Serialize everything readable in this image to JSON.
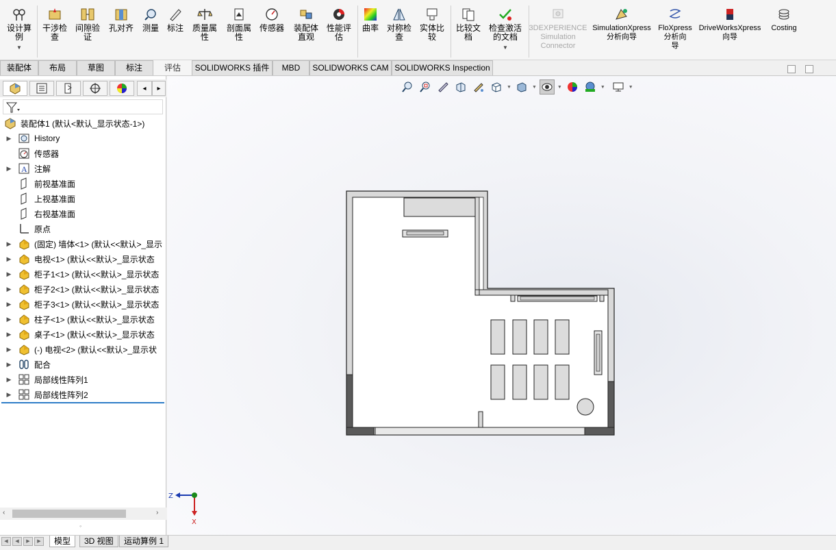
{
  "ribbon": {
    "buttons": [
      {
        "label": "设计算\n例",
        "icon": "design-study-icon"
      },
      {
        "label": "干涉检\n查",
        "icon": "interference-icon"
      },
      {
        "label": "间隙验\n证",
        "icon": "clearance-icon"
      },
      {
        "label": "孔对齐",
        "icon": "hole-align-icon"
      },
      {
        "label": "测量",
        "icon": "measure-icon"
      },
      {
        "label": "标注",
        "icon": "markup-icon"
      },
      {
        "label": "质量属\n性",
        "icon": "mass-props-icon"
      },
      {
        "label": "剖面属\n性",
        "icon": "section-props-icon"
      },
      {
        "label": "传感器",
        "icon": "sensor-icon"
      },
      {
        "label": "装配体\n直观",
        "icon": "assembly-visual-icon"
      },
      {
        "label": "性能评\n估",
        "icon": "performance-icon"
      },
      {
        "label": "曲率",
        "icon": "curvature-icon"
      },
      {
        "label": "对称检\n查",
        "icon": "symmetry-icon"
      },
      {
        "label": "实体比\n较",
        "icon": "body-compare-icon"
      },
      {
        "label": "比较文\n档",
        "icon": "compare-docs-icon"
      },
      {
        "label": "检查激活\n的文档",
        "icon": "check-doc-icon"
      },
      {
        "label": "3DEXPERIENCE\nSimulation\nConnector",
        "icon": "3dx-icon"
      },
      {
        "label": "SimulationXpress\n分析向导",
        "icon": "simxpress-icon"
      },
      {
        "label": "FloXpress\n分析向\n导",
        "icon": "floxpress-icon"
      },
      {
        "label": "DriveWorksXpress\n向导",
        "icon": "driveworks-icon"
      },
      {
        "label": "Costing",
        "icon": "costing-icon"
      }
    ]
  },
  "tabs": [
    {
      "label": "装配体"
    },
    {
      "label": "布局"
    },
    {
      "label": "草图"
    },
    {
      "label": "标注"
    },
    {
      "label": "评估"
    },
    {
      "label": "SOLIDWORKS 插件"
    },
    {
      "label": "MBD"
    },
    {
      "label": "SOLIDWORKS CAM"
    },
    {
      "label": "SOLIDWORKS Inspection"
    }
  ],
  "tree": {
    "root": "装配体1  (默认<默认_显示状态-1>)",
    "items": [
      {
        "label": "History",
        "icon": "history-icon"
      },
      {
        "label": "传感器",
        "icon": "sensor-icon"
      },
      {
        "label": "注解",
        "icon": "annotation-icon"
      },
      {
        "label": "前视基准面",
        "icon": "plane-icon"
      },
      {
        "label": "上视基准面",
        "icon": "plane-icon"
      },
      {
        "label": "右视基准面",
        "icon": "plane-icon"
      },
      {
        "label": "原点",
        "icon": "origin-icon"
      },
      {
        "label": "(固定) 墙体<1> (默认<<默认>_显示",
        "icon": "part-icon"
      },
      {
        "label": "电视<1> (默认<<默认>_显示状态",
        "icon": "part-icon"
      },
      {
        "label": "柜子1<1> (默认<<默认>_显示状态",
        "icon": "part-icon"
      },
      {
        "label": "柜子2<1> (默认<<默认>_显示状态",
        "icon": "part-icon"
      },
      {
        "label": "柜子3<1> (默认<<默认>_显示状态",
        "icon": "part-icon"
      },
      {
        "label": "柱子<1> (默认<<默认>_显示状态",
        "icon": "part-icon"
      },
      {
        "label": "桌子<1> (默认<<默认>_显示状态",
        "icon": "part-icon"
      },
      {
        "label": "(-) 电视<2> (默认<<默认>_显示状",
        "icon": "part-icon"
      },
      {
        "label": "配合",
        "icon": "mate-icon"
      },
      {
        "label": "局部线性阵列1",
        "icon": "pattern-icon"
      },
      {
        "label": "局部线性阵列2",
        "icon": "pattern-icon"
      }
    ]
  },
  "bottom_tabs": [
    {
      "label": "模型"
    },
    {
      "label": "3D 视图"
    },
    {
      "label": "运动算例 1"
    }
  ],
  "triad": {
    "z": "Z",
    "x": "X"
  },
  "colors": {
    "accent": "#2d7cc7",
    "wall_fill": "#d9d9d9",
    "wall_dark": "#5a5a5a"
  }
}
